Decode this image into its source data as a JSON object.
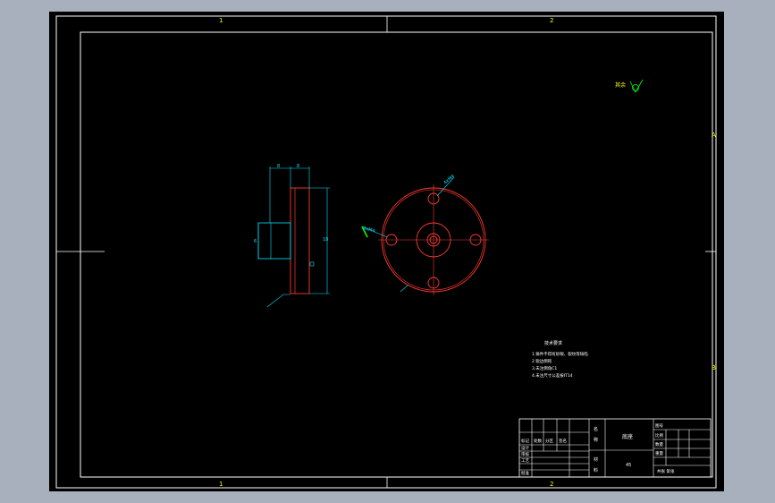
{
  "colors": {
    "background": "#a7b0bc",
    "canvas": "#000000",
    "frame": "#ffffff",
    "part": "#ff3b30",
    "dimension": "#00e5ff",
    "annotation": "#ffff00",
    "note": "#ffffff",
    "leader": "#00ff00"
  },
  "zone_labels": {
    "top_1": "1",
    "top_2": "2",
    "bottom_1": "1",
    "bottom_2": "2",
    "right_a": "A",
    "right_b": "B"
  },
  "roughness": {
    "prefix": "其余"
  },
  "dimensions": {
    "side_top_left": "8",
    "side_top_right": "8",
    "side_height": "18",
    "side_hub": "6",
    "front_hole_top": "4xM4",
    "front_hole_left": "4xM4"
  },
  "notes": {
    "title": "技术要求",
    "lines": [
      "1.铸件不得有砂眼、裂纹等缺陷",
      "2.锐边倒钝",
      "3.未注倒角C1",
      "4.未注尺寸公差按IT14"
    ]
  },
  "title_block": {
    "part_name": "底座",
    "material": "45",
    "left_labels": [
      "标记",
      "处数",
      "分区",
      "签名",
      "设计",
      "审核",
      "工艺",
      "批准"
    ],
    "mid_labels": [
      "名",
      "称",
      "材",
      "料"
    ],
    "right_labels": [
      "图号",
      "比例",
      "数量",
      "重量",
      "共张 第张"
    ]
  }
}
